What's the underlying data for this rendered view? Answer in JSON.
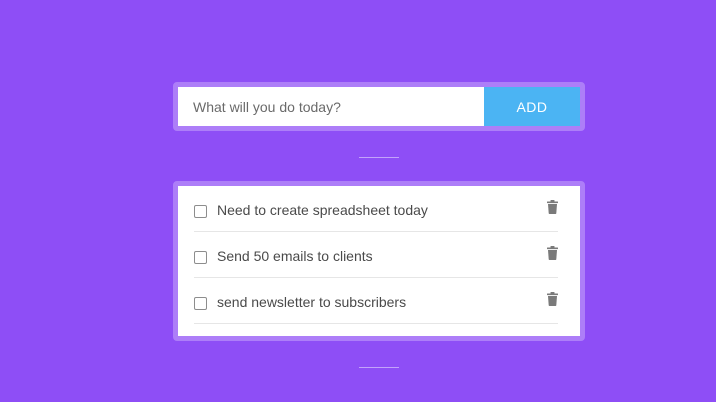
{
  "new_todo": {
    "placeholder": "What will you do today?",
    "value": "",
    "add_label": "ADD"
  },
  "todos": [
    {
      "label": "Need to create spreadsheet today",
      "checked": false,
      "delete_icon": "trash-icon"
    },
    {
      "label": "Send 50 emails to clients",
      "checked": false,
      "delete_icon": "trash-icon"
    },
    {
      "label": "send newsletter to subscribers",
      "checked": false,
      "delete_icon": "trash-icon"
    }
  ],
  "colors": {
    "background": "#8e4ef6",
    "panel_border": "#ad7ef8",
    "add_button": "#4bb4f3",
    "text": "#4a4a4a",
    "icon": "#7a7a7a"
  }
}
